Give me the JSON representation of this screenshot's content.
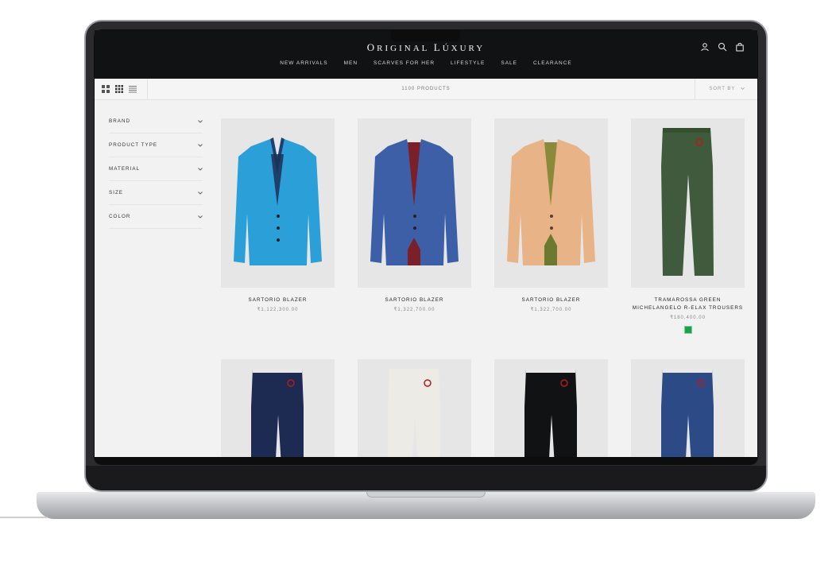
{
  "store": {
    "logo_first": "O",
    "logo_rest_1": "RIGINAL ",
    "logo_second": "L",
    "logo_rest_2": "ÚXURY"
  },
  "nav": [
    "NEW ARRIVALS",
    "MEN",
    "SCARVES FOR HER",
    "LIFESTYLE",
    "SALE",
    "CLEARANCE"
  ],
  "header_icons": [
    "account-icon",
    "search-icon",
    "bag-icon"
  ],
  "toolbar": {
    "product_count": "1100 PRODUCTS",
    "sort_label": "SORT BY"
  },
  "view_modes": [
    "grid-large-icon",
    "grid-small-icon",
    "list-icon"
  ],
  "filters": [
    "BRAND",
    "PRODUCT TYPE",
    "MATERIAL",
    "SIZE",
    "COLOR"
  ],
  "products": [
    {
      "name": "SARTORIO BLAZER",
      "price": "₹1,122,300.00",
      "color": "#2b9fd8"
    },
    {
      "name": "SARTORIO BLAZER",
      "price": "₹1,322,700.00",
      "color": "#3d5fa8"
    },
    {
      "name": "SARTORIO BLAZER",
      "price": "₹1,322,700.00",
      "color": "#e8b386"
    },
    {
      "name": "TRAMAROSSA GREEN MICHELANGELO R-ELAX TROUSERS",
      "price": "₹180,400.00",
      "color": "#3f5a3c",
      "swatch": "#1aa14a"
    }
  ],
  "products_row2": [
    {
      "color": "#1d2a52"
    },
    {
      "color": "#ecebe6"
    },
    {
      "color": "#111214"
    },
    {
      "color": "#2c4a86"
    }
  ]
}
